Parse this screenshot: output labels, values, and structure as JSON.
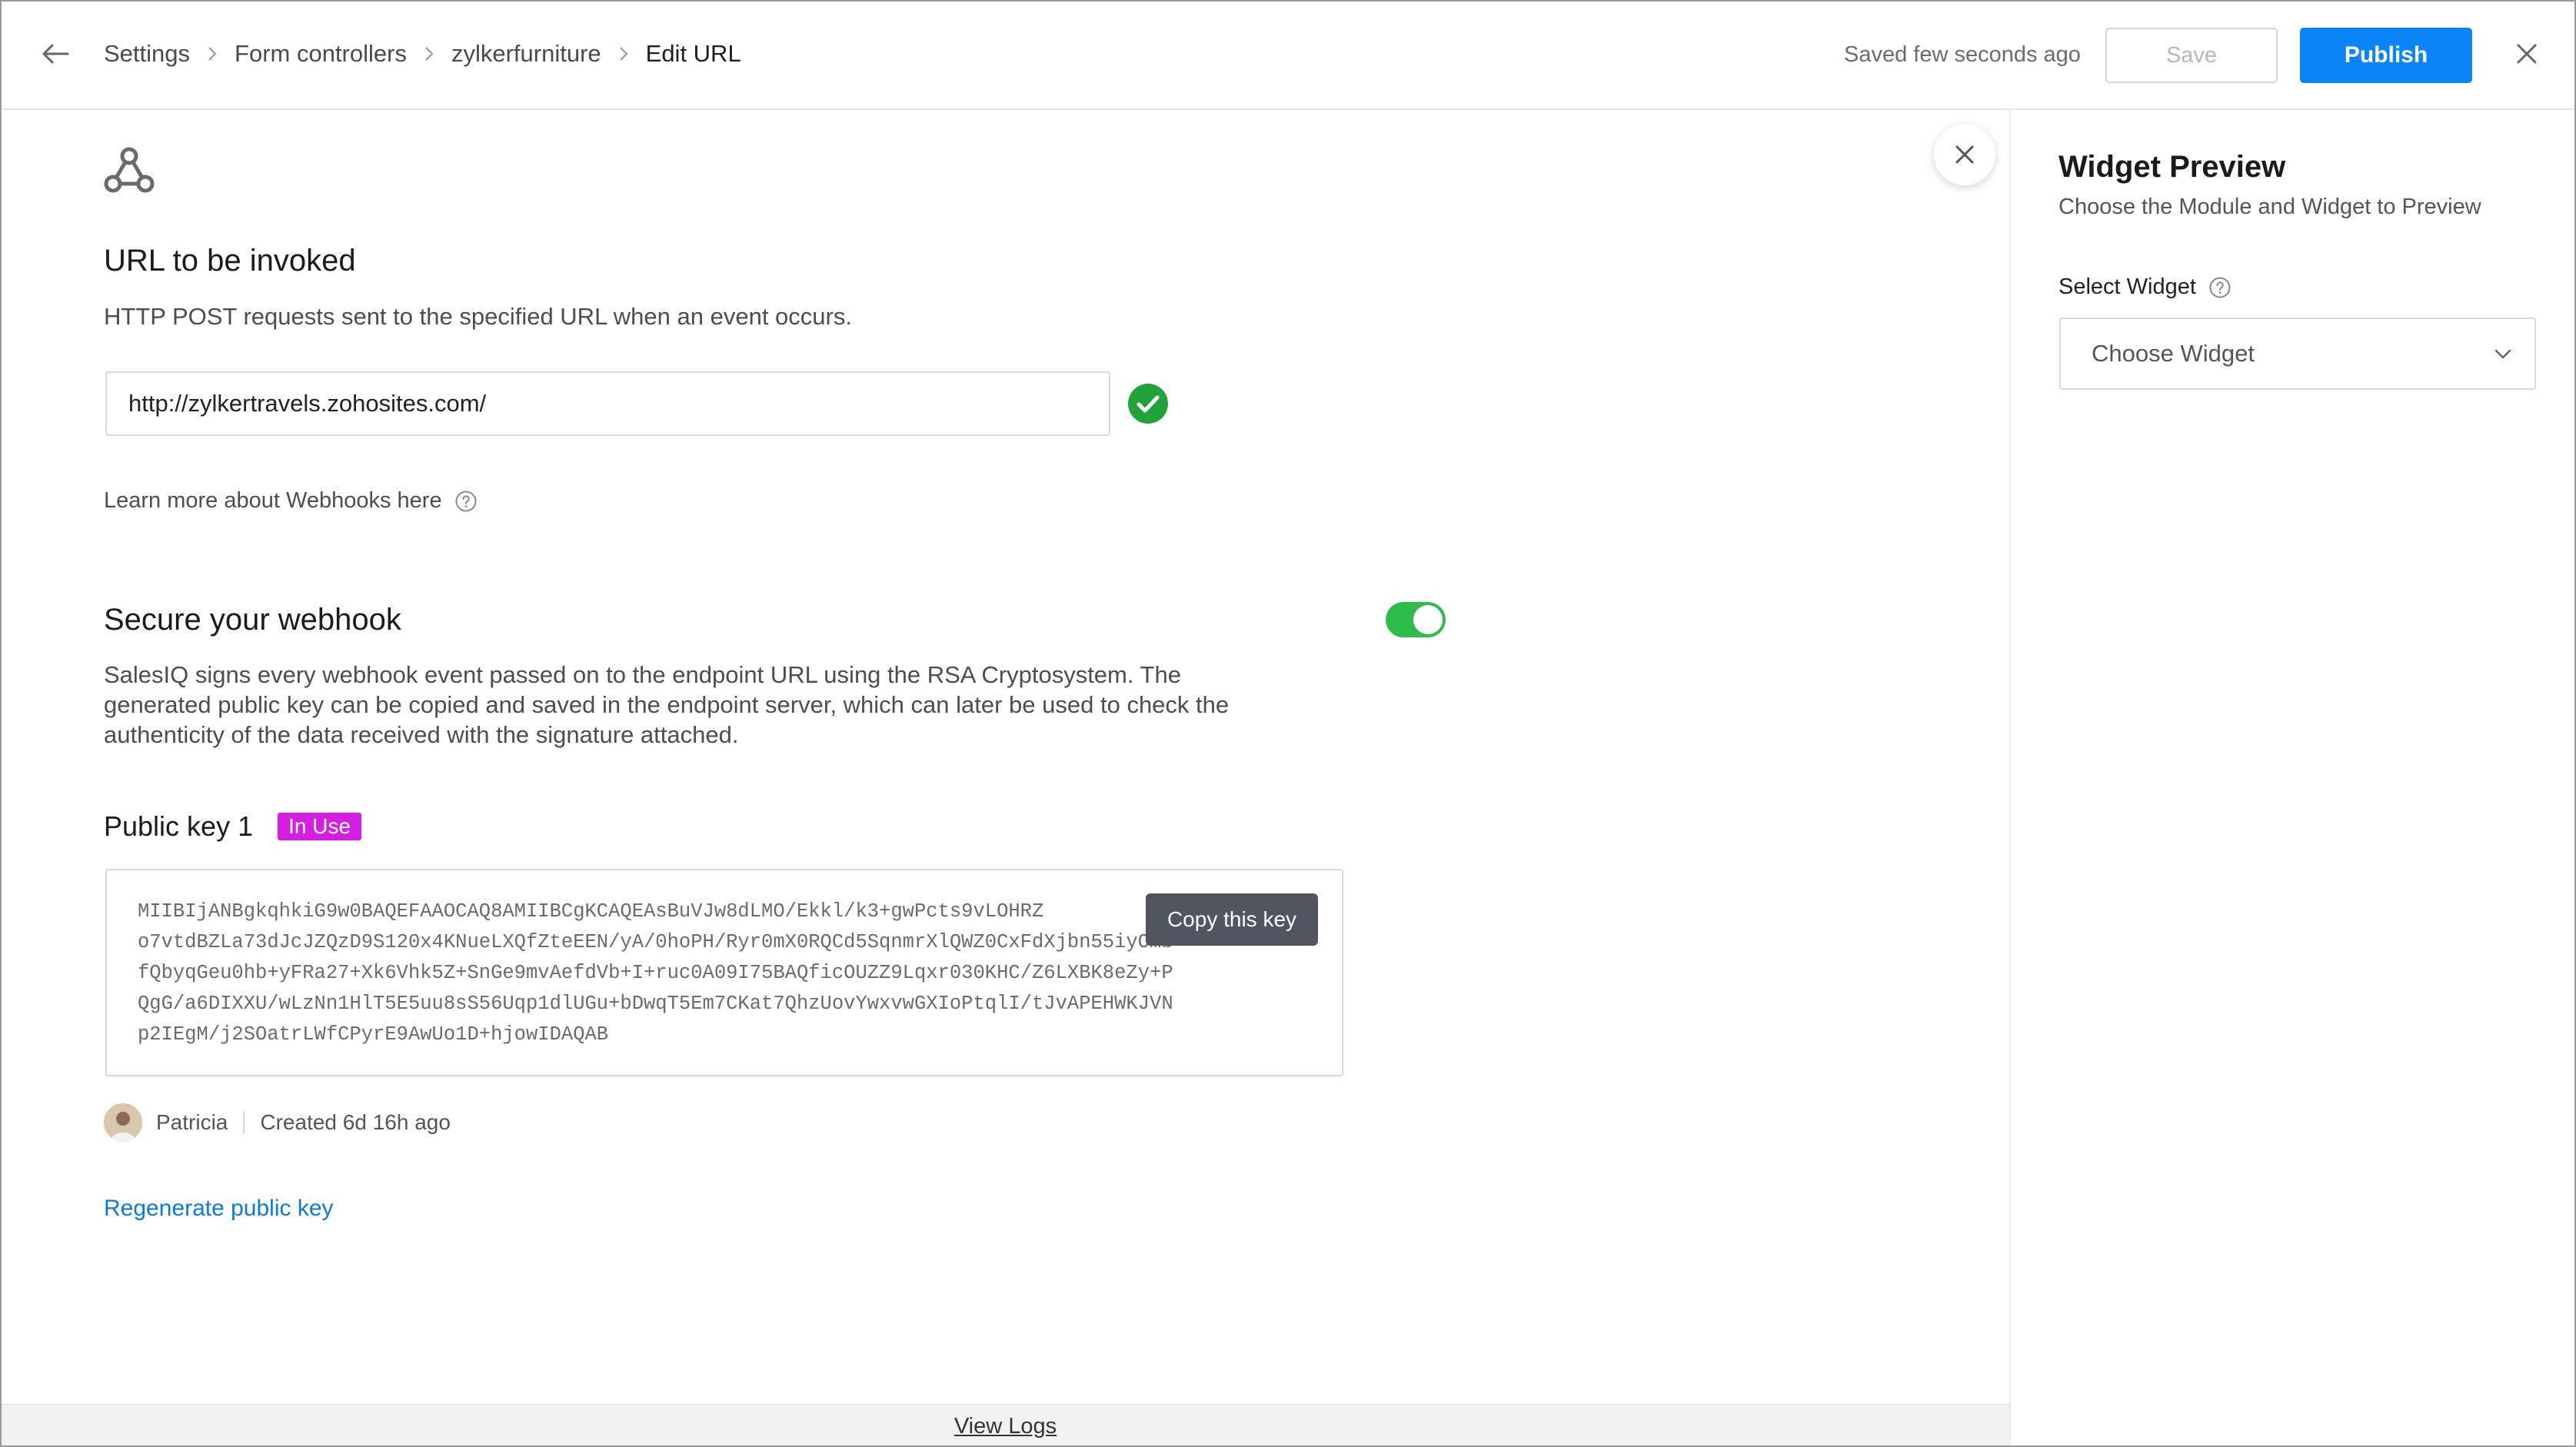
{
  "header": {
    "breadcrumbs": [
      "Settings",
      "Form controllers",
      "zylkerfurniture",
      "Edit URL"
    ],
    "saved_status": "Saved few seconds ago",
    "save_label": "Save",
    "publish_label": "Publish"
  },
  "url_section": {
    "title": "URL to be invoked",
    "description": "HTTP POST requests sent to the specified URL when an event occurs.",
    "url_value": "http://zylkertravels.zohosites.com/",
    "learn_more": "Learn more about Webhooks here"
  },
  "secure_section": {
    "title": "Secure your webhook",
    "toggle_on": true,
    "description": "SalesIQ signs every webhook event passed on to the endpoint URL using the RSA Cryptosystem. The generated public key can be copied and saved in the endpoint server, which can later be used to check the authenticity of the data received with the signature attached."
  },
  "public_key": {
    "title": "Public key 1",
    "badge": "In Use",
    "key_lines": [
      "MIIBIjANBgkqhkiG9w0BAQEFAAOCAQ8AMIIBCgKCAQEAsBuVJw8dLMO/Ekkl/k3+gwPcts9vLOHRZ",
      "o7vtdBZLa73dJcJZQzD9S120x4KNueLXQfZteEEN/yA/0hoPH/Ryr0mX0RQCd5SqnmrXlQWZ0CxFdXjbn55iyOmb",
      "fQbyqGeu0hb+yFRa27+Xk6Vhk5Z+SnGe9mvAefdVb+I+ruc0A09I75BAQficOUZZ9Lqxr030KHC/Z6LXBK8eZy+P",
      "QgG/a6DIXXU/wLzNn1HlT5E5uu8sS56Uqp1dlUGu+bDwqT5Em7CKat7QhzUovYwxvwGXIoPtqlI/tJvAPEHWKJVN",
      "p2IEgM/j2SOatrLWfCPyrE9AwUo1D+hjowIDAQAB"
    ],
    "tooltip": "Copy this key",
    "author": "Patricia",
    "created": "Created 6d 16h ago",
    "regenerate": "Regenerate public key"
  },
  "footer": {
    "view_logs": "View Logs"
  },
  "preview": {
    "title": "Widget Preview",
    "subtitle": "Choose the Module and Widget to Preview",
    "select_label": "Select Widget",
    "select_placeholder": "Choose Widget"
  },
  "colors": {
    "accent": "#0b84f5",
    "success": "#2ebd4a",
    "badge": "#d61ee2",
    "link": "#0b7ad8"
  },
  "icons": [
    "back-arrow-icon",
    "chevron-right-icon",
    "close-icon",
    "webhook-icon",
    "check-circle-icon",
    "help-circle-icon",
    "chevron-down-icon"
  ]
}
